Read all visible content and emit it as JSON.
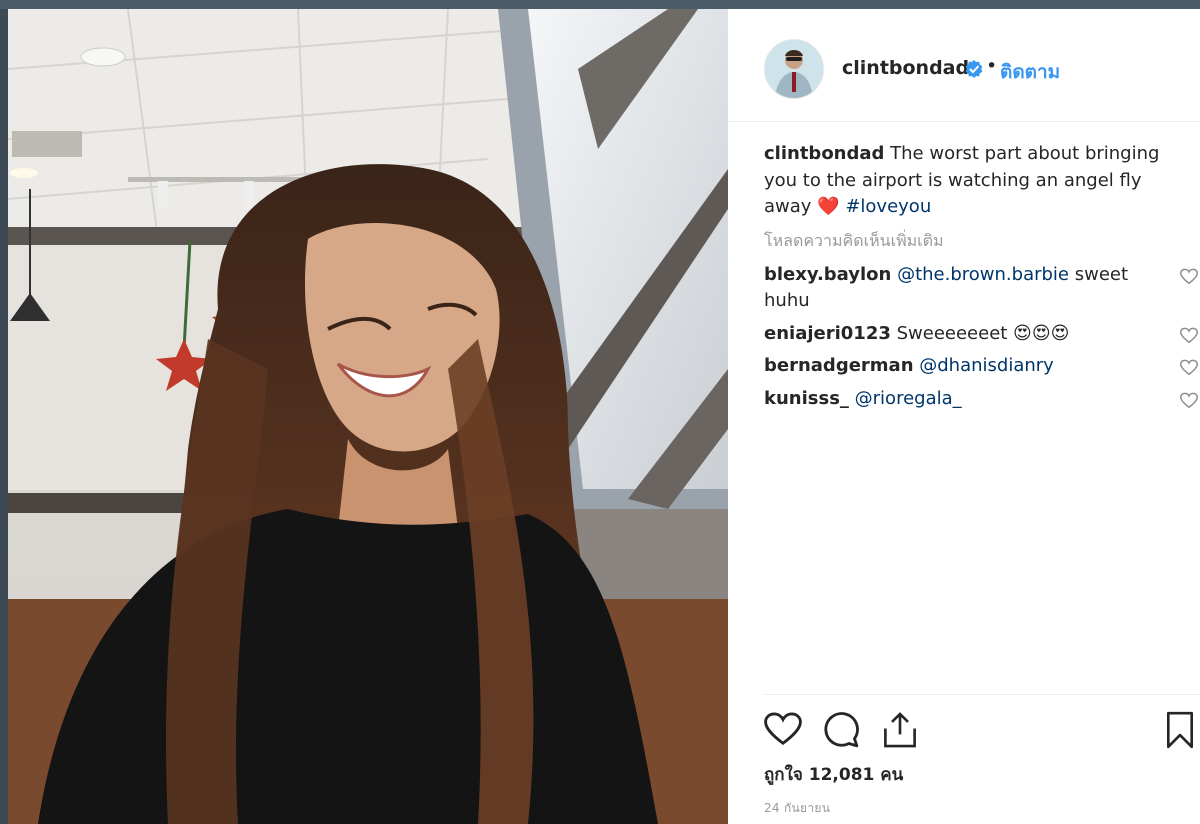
{
  "post": {
    "username": "clintbondad",
    "follow_label": "ติดตาม",
    "separator": "•",
    "caption": {
      "username": "clintbondad",
      "text": "The worst part about bringing you to the airport is watching an angel fly away",
      "emoji": "❤️",
      "hashtag": "#loveyou"
    },
    "load_more": "โหลดความคิดเห็นเพิ่มเติม",
    "comments": [
      {
        "username": "blexy.baylon",
        "mention": "@the.brown.barbie",
        "text": "sweet huhu"
      },
      {
        "username": "eniajeri0123",
        "mention": "",
        "text": "Sweeeeeeet 😍😍😍"
      },
      {
        "username": "bernadgerman",
        "mention": "@dhanisdianry",
        "text": ""
      },
      {
        "username": "kunisss_",
        "mention": "@rioregala_",
        "text": ""
      }
    ],
    "likes": "ถูกใจ 12,081 คน",
    "date": "24 กันยายน"
  },
  "icons": {
    "verified": "verified-badge-icon",
    "like": "heart-icon",
    "comment": "comment-bubble-icon",
    "share": "share-icon",
    "save": "bookmark-icon"
  },
  "colors": {
    "link_blue": "#3897f0",
    "hashtag_blue": "#003569",
    "muted": "#999999",
    "text": "#262626"
  }
}
